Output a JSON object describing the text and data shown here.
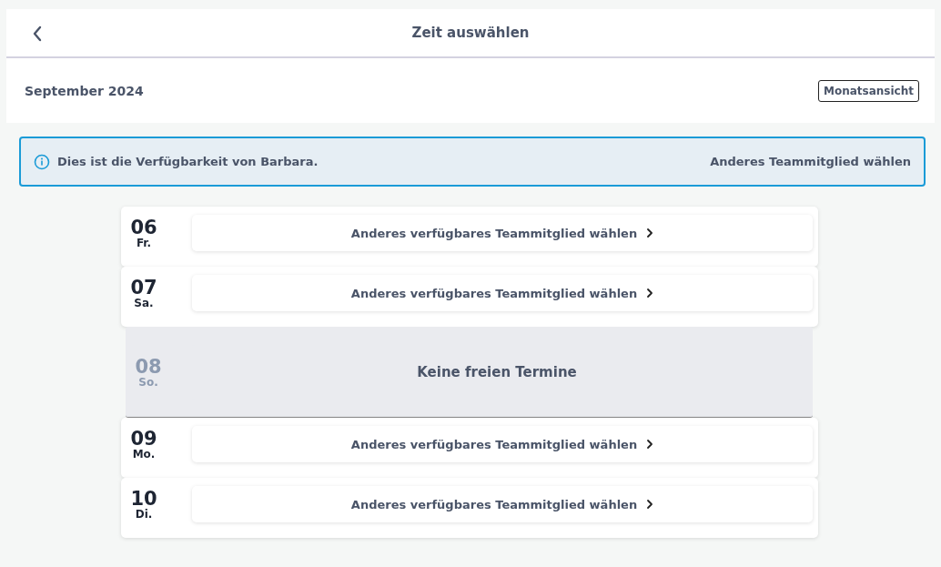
{
  "header": {
    "title": "Zeit auswählen"
  },
  "month": {
    "label": "September 2024",
    "view_button": "Monatsansicht"
  },
  "info_banner": {
    "text": "Dies ist die Verfügbarkeit von Barbara.",
    "link": "Anderes Teammitglied wählen"
  },
  "days": [
    {
      "day": "06",
      "weekday": "Fr.",
      "kind": "choose",
      "label": "Anderes verfügbares Teammitglied wählen"
    },
    {
      "day": "07",
      "weekday": "Sa.",
      "kind": "choose",
      "label": "Anderes verfügbares Teammitglied wählen"
    },
    {
      "day": "08",
      "weekday": "So.",
      "kind": "empty",
      "label": "Keine freien Termine"
    },
    {
      "day": "09",
      "weekday": "Mo.",
      "kind": "choose",
      "label": "Anderes verfügbares Teammitglied wählen"
    },
    {
      "day": "10",
      "weekday": "Di.",
      "kind": "choose",
      "label": "Anderes verfügbares Teammitglied wählen"
    }
  ]
}
